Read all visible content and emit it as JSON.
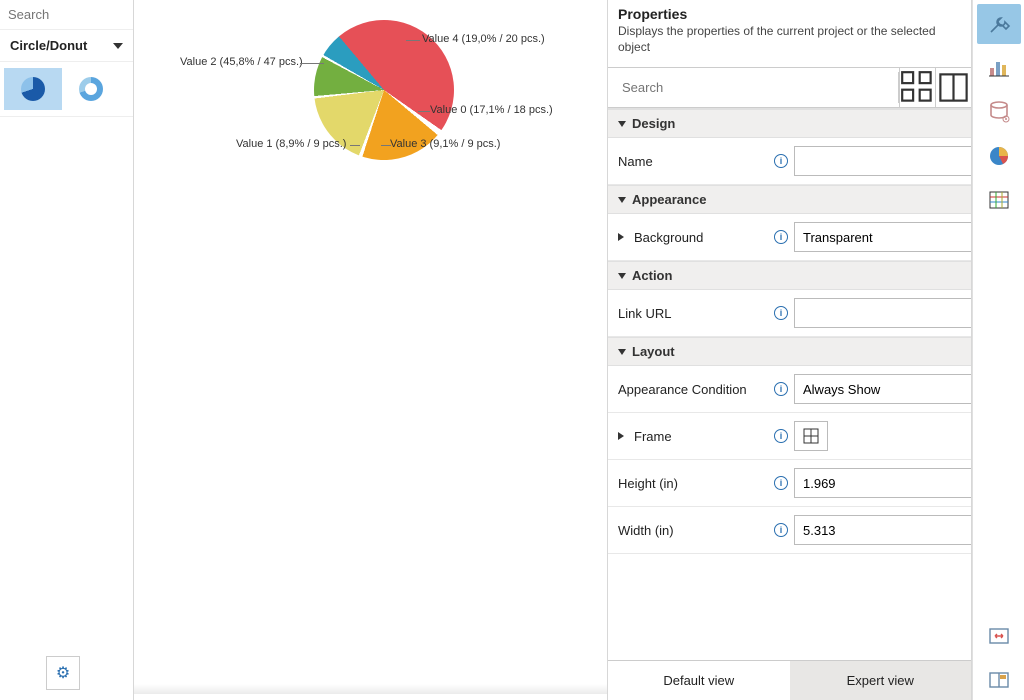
{
  "chart_data": {
    "type": "pie",
    "title": "",
    "slices": [
      {
        "label": "Value 2",
        "percent": 45.8,
        "count": 47,
        "color": "#e65057"
      },
      {
        "label": "Value 4",
        "percent": 19.0,
        "count": 20,
        "color": "#f2a21f"
      },
      {
        "label": "Value 0",
        "percent": 17.1,
        "count": 18,
        "color": "#e3d86a"
      },
      {
        "label": "Value 3",
        "percent": 9.1,
        "count": 9,
        "color": "#73af40"
      },
      {
        "label": "Value 1",
        "percent": 8.9,
        "count": 9,
        "color": "#2b9dbf"
      }
    ],
    "label_format": "{label} ({percent}% / {count} pcs.)"
  },
  "leftPanel": {
    "search_placeholder": "Search",
    "chart_type_header": "Circle/Donut"
  },
  "pieLabels": {
    "v2": "Value 2 (45,8% / 47 pcs.)",
    "v4": "Value 4 (19,0% / 20 pcs.)",
    "v0": "Value 0 (17,1% / 18 pcs.)",
    "v3": "Value 3 (9,1% / 9 pcs.)",
    "v1": "Value 1 (8,9% / 9 pcs.)"
  },
  "properties": {
    "title": "Properties",
    "description": "Displays the properties of the current project or the selected object",
    "search_placeholder": "Search",
    "groups": {
      "design": "Design",
      "appearance": "Appearance",
      "action": "Action",
      "layout": "Layout"
    },
    "rows": {
      "name_label": "Name",
      "name_value": "",
      "background_label": "Background",
      "background_value": "Transparent",
      "linkurl_label": "Link URL",
      "linkurl_value": "",
      "appearance_condition_label": "Appearance Condition",
      "appearance_condition_value": "Always Show",
      "frame_label": "Frame",
      "height_label": "Height (in)",
      "height_value": "1.969",
      "width_label": "Width (in)",
      "width_value": "5.313"
    },
    "views": {
      "default": "Default view",
      "expert": "Expert view"
    }
  }
}
